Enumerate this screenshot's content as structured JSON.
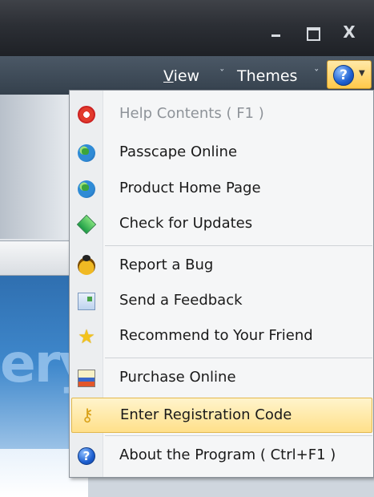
{
  "menubar": {
    "view_pre": "",
    "view_underlined": "V",
    "view_rest": "iew",
    "themes": "Themes",
    "chevron": "ˇ"
  },
  "window": {
    "close_glyph": "X"
  },
  "background": {
    "partial_text": "ery"
  },
  "help_menu": {
    "items": [
      {
        "label": "Help Contents ( F1 )",
        "icon": "help-lifebuoy-icon",
        "enabled": false
      },
      {
        "label": "Passcape Online",
        "icon": "globe-icon",
        "enabled": true
      },
      {
        "label": "Product Home Page",
        "icon": "globe-icon",
        "enabled": true
      },
      {
        "label": "Check for Updates",
        "icon": "update-diamond-icon",
        "enabled": true
      },
      {
        "label": "Report a Bug",
        "icon": "bug-icon",
        "enabled": true
      },
      {
        "label": "Send a Feedback",
        "icon": "feedback-icon",
        "enabled": true
      },
      {
        "label": "Recommend to Your Friend",
        "icon": "star-icon",
        "enabled": true
      },
      {
        "label": "Purchase Online",
        "icon": "purchase-icon",
        "enabled": true
      },
      {
        "label": "Enter Registration Code",
        "icon": "key-icon",
        "enabled": true,
        "highlighted": true
      },
      {
        "label": "About the Program ( Ctrl+F1 )",
        "icon": "about-question-icon",
        "enabled": true
      }
    ]
  },
  "colors": {
    "highlight": "#ffe08a",
    "titlebar": "#2c2f35",
    "menubar": "#34404c"
  }
}
